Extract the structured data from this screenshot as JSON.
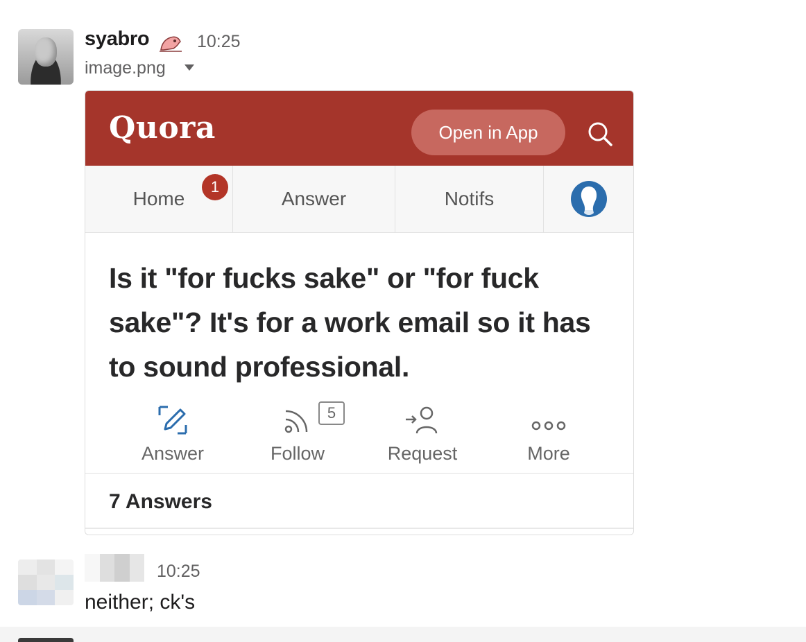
{
  "message1": {
    "username": "syabro",
    "status_icon": "bird-emoji-icon",
    "timestamp": "10:25",
    "attachment_name": "image.png"
  },
  "quora": {
    "logo": "Quora",
    "open_in_app": "Open in App",
    "tabs": [
      {
        "label": "Home",
        "badge": "1"
      },
      {
        "label": "Answer"
      },
      {
        "label": "Notifs"
      }
    ],
    "question": "Is it \"for fucks sake\" or \"for fuck sake\"? It's for a work email so it has to sound professional.",
    "actions": [
      {
        "label": "Answer",
        "icon": "pencil-icon"
      },
      {
        "label": "Follow",
        "icon": "rss-icon",
        "count": "5"
      },
      {
        "label": "Request",
        "icon": "request-user-icon"
      },
      {
        "label": "More",
        "icon": "more-dots-icon"
      }
    ],
    "answers_count": "7 Answers",
    "colors": {
      "header": "#a5352b",
      "accent": "#2b6dad"
    }
  },
  "message2": {
    "timestamp": "10:25",
    "text": "neither; ck's"
  }
}
